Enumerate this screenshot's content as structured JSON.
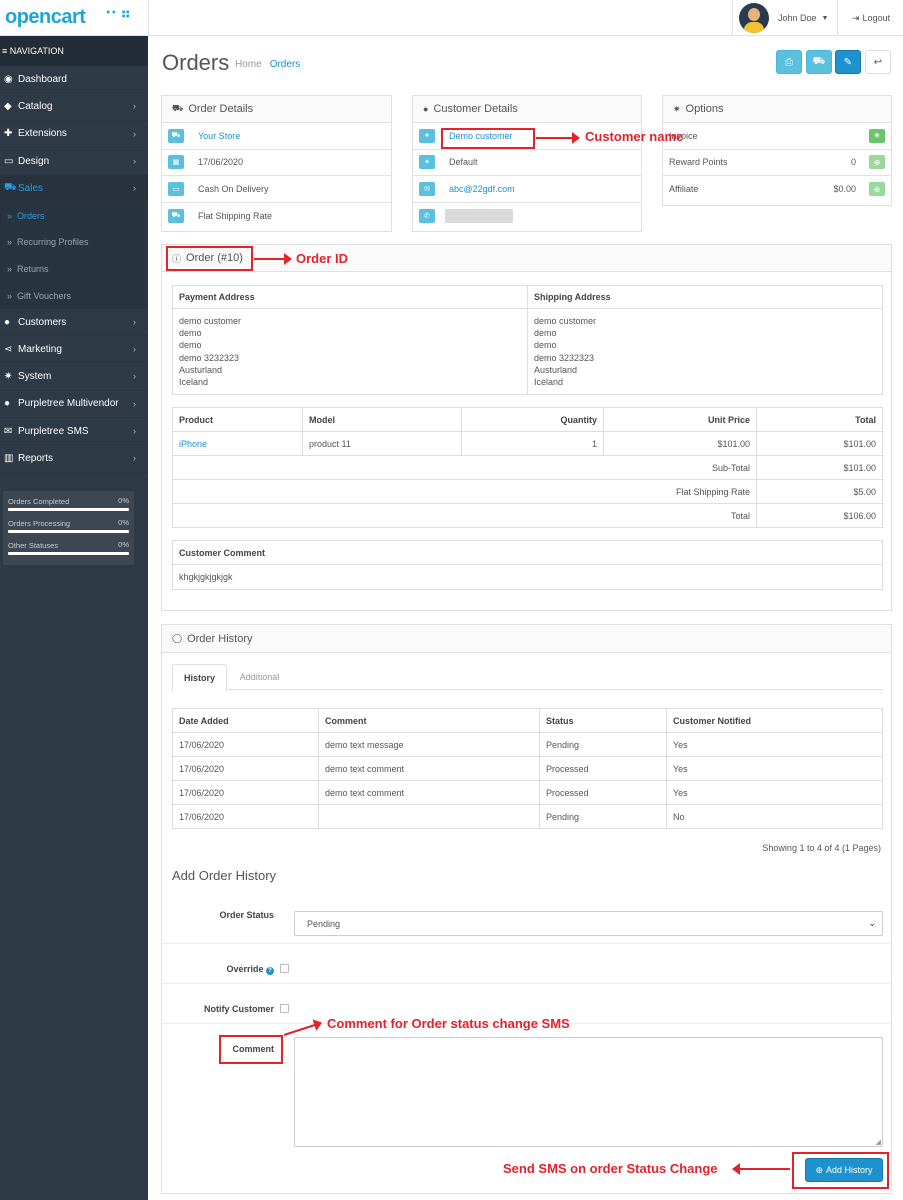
{
  "header": {
    "logo": "opencart",
    "user": "John Doe",
    "logout": "Logout"
  },
  "sidebar": {
    "heading": "≡ NAVIGATION",
    "items": [
      {
        "label": "Dashboard",
        "icon": "dashboard-icon"
      },
      {
        "label": "Catalog",
        "icon": "tag-icon"
      },
      {
        "label": "Extensions",
        "icon": "puzzle-icon"
      },
      {
        "label": "Design",
        "icon": "monitor-icon"
      },
      {
        "label": "Sales",
        "icon": "cart-icon"
      },
      {
        "label": "Customers",
        "icon": "user-icon"
      },
      {
        "label": "Marketing",
        "icon": "share-icon"
      },
      {
        "label": "System",
        "icon": "gear-icon"
      },
      {
        "label": "Purpletree Multivendor",
        "icon": "user-icon"
      },
      {
        "label": "Purpletree SMS",
        "icon": "envelope-icon"
      },
      {
        "label": "Reports",
        "icon": "bar-chart-icon"
      }
    ],
    "sales_sub": [
      "Orders",
      "Recurring Profiles",
      "Returns",
      "Gift Vouchers"
    ],
    "stats": [
      {
        "label": "Orders Completed",
        "pct": "0%"
      },
      {
        "label": "Orders Processing",
        "pct": "0%"
      },
      {
        "label": "Other Statuses",
        "pct": "0%"
      }
    ]
  },
  "page": {
    "title": "Orders",
    "breadcrumb": [
      "Home",
      "Orders"
    ]
  },
  "order_details": {
    "title": "Order Details",
    "store": "Your Store",
    "date": "17/06/2020",
    "payment": "Cash On Delivery",
    "shipping": "Flat Shipping Rate"
  },
  "customer_details": {
    "title": "Customer Details",
    "name": "Demo customer",
    "group": "Default",
    "email": "abc@22gdf.com",
    "phone": ""
  },
  "options": {
    "title": "Options",
    "invoice_label": "Invoice",
    "reward_label": "Reward Points",
    "reward_value": "0",
    "affiliate_label": "Affiliate",
    "affiliate_value": "$0.00"
  },
  "order": {
    "title": "Order (#10)",
    "payment_address_hd": "Payment Address",
    "shipping_address_hd": "Shipping Address",
    "payment_address": [
      "demo customer",
      "demo",
      "demo",
      "demo 3232323",
      "Austurland",
      "Iceland"
    ],
    "shipping_address": [
      "demo customer",
      "demo",
      "demo",
      "demo 3232323",
      "Austurland",
      "Iceland"
    ],
    "columns": [
      "Product",
      "Model",
      "Quantity",
      "Unit Price",
      "Total"
    ],
    "product": {
      "name": "iPhone",
      "model": "product 11",
      "qty": "1",
      "unit": "$101.00",
      "total": "$101.00"
    },
    "totals": [
      {
        "label": "Sub-Total",
        "value": "$101.00"
      },
      {
        "label": "Flat Shipping Rate",
        "value": "$5.00"
      },
      {
        "label": "Total",
        "value": "$106.00"
      }
    ],
    "comment_hd": "Customer Comment",
    "comment": "khgkjgkjgkjgk"
  },
  "history": {
    "title": "Order History",
    "tabs": [
      "History",
      "Additional"
    ],
    "columns": [
      "Date Added",
      "Comment",
      "Status",
      "Customer Notified"
    ],
    "rows": [
      [
        "17/06/2020",
        "demo text message",
        "Pending",
        "Yes"
      ],
      [
        "17/06/2020",
        "demo text comment",
        "Processed",
        "Yes"
      ],
      [
        "17/06/2020",
        "demo text comment",
        "Processed",
        "Yes"
      ],
      [
        "17/06/2020",
        "",
        "Pending",
        "No"
      ]
    ],
    "showing": "Showing 1 to 4 of 4 (1 Pages)",
    "add_title": "Add Order History",
    "status_label": "Order Status",
    "status_value": "Pending",
    "override_label": "Override",
    "notify_label": "Notify Customer",
    "comment_label": "Comment",
    "add_button": "Add History"
  },
  "annotations": {
    "customer_name": "Customer name",
    "order_id": "Order ID",
    "comment_sms": "Comment for Order status change SMS",
    "send_sms": "Send SMS on order Status Change"
  }
}
